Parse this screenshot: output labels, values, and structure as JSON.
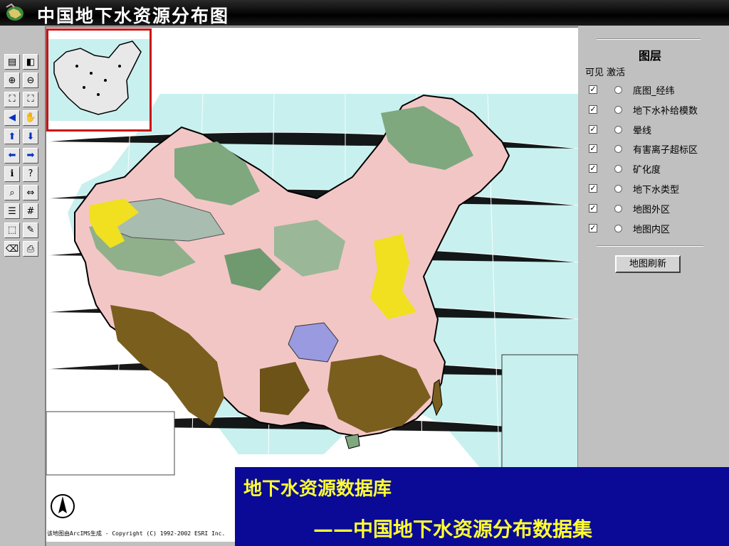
{
  "window": {
    "title": "中国地下水资源分布图"
  },
  "toolbar": {
    "tools": [
      {
        "name": "legend-toggle-icon",
        "glyph": "▤"
      },
      {
        "name": "overview-toggle-icon",
        "glyph": "◧"
      },
      {
        "name": "zoom-in-icon",
        "glyph": "⊕"
      },
      {
        "name": "zoom-out-icon",
        "glyph": "⊖"
      },
      {
        "name": "zoom-full-icon",
        "glyph": "⛶"
      },
      {
        "name": "zoom-active-icon",
        "glyph": "⛶"
      },
      {
        "name": "back-extent-icon",
        "glyph": "◀"
      },
      {
        "name": "pan-hand-icon",
        "glyph": "✋"
      },
      {
        "name": "pan-north-icon",
        "glyph": "⬆"
      },
      {
        "name": "pan-south-icon",
        "glyph": "⬇"
      },
      {
        "name": "pan-west-icon",
        "glyph": "⬅"
      },
      {
        "name": "pan-east-icon",
        "glyph": "➡"
      },
      {
        "name": "identify-icon",
        "glyph": "ℹ"
      },
      {
        "name": "query-icon",
        "glyph": "?"
      },
      {
        "name": "find-icon",
        "glyph": "⌕"
      },
      {
        "name": "measure-icon",
        "glyph": "⇔"
      },
      {
        "name": "buffer-icon",
        "glyph": "☰"
      },
      {
        "name": "grid-icon",
        "glyph": "#"
      },
      {
        "name": "select-rect-icon",
        "glyph": "⬚"
      },
      {
        "name": "select-point-icon",
        "glyph": "✎"
      },
      {
        "name": "clear-selection-icon",
        "glyph": "⌫"
      },
      {
        "name": "print-icon",
        "glyph": "⎙"
      }
    ]
  },
  "layers_panel": {
    "title": "图层",
    "col_visible": "可见",
    "col_active": "激活",
    "layers": [
      {
        "label": "底图_经纬",
        "visible": true
      },
      {
        "label": "地下水补给模数",
        "visible": true
      },
      {
        "label": "晕线",
        "visible": true
      },
      {
        "label": "有害离子超标区",
        "visible": true
      },
      {
        "label": "矿化度",
        "visible": true
      },
      {
        "label": "地下水类型",
        "visible": true
      },
      {
        "label": "地图外区",
        "visible": true
      },
      {
        "label": "地图内区",
        "visible": true
      }
    ],
    "refresh_label": "地图刷新"
  },
  "map": {
    "credit": "该地图由ArcIMS生成 - Copyright (C) 1992-2002 ESRI Inc.",
    "colors": {
      "sea": "#c8f0ee",
      "pink": "#f3c6c6",
      "green": "#7fa87f",
      "olive": "#7a5e1e",
      "yellow": "#f0e020",
      "gray": "#b8c8c0",
      "purple": "#9a9ae0"
    }
  },
  "caption": {
    "line1": "地下水资源数据库",
    "line2": "——中国地下水资源分布数据集"
  }
}
